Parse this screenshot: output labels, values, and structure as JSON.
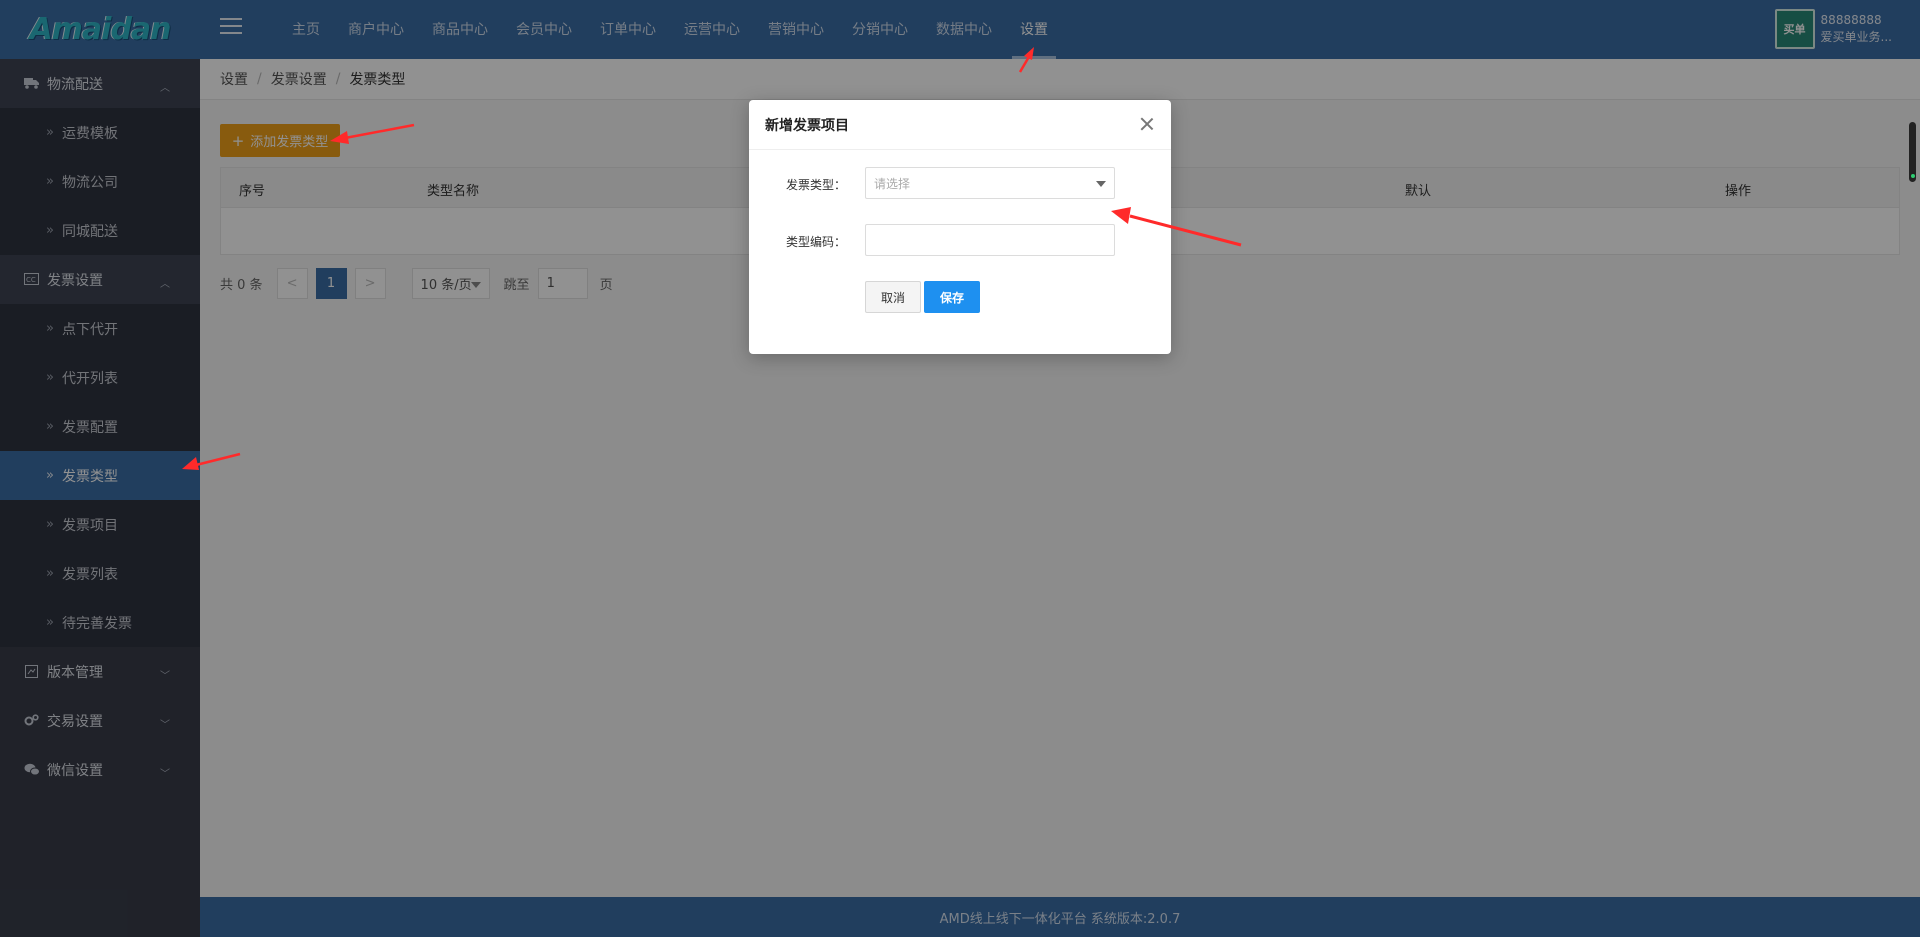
{
  "app": {
    "logo": "Amaidan"
  },
  "topnav": {
    "items": [
      "主页",
      "商户中心",
      "商品中心",
      "会员中心",
      "订单中心",
      "运营中心",
      "营销中心",
      "分销中心",
      "数据中心",
      "设置"
    ],
    "active": "设置"
  },
  "user": {
    "id": "88888888",
    "name": "爱买单业务...",
    "avatar_text": "买单"
  },
  "sidebar": {
    "groups": [
      {
        "label": "物流配送",
        "icon": "truck-icon",
        "open": true,
        "items": [
          "运费模板",
          "物流公司",
          "同城配送"
        ]
      },
      {
        "label": "发票设置",
        "icon": "invoice-icon",
        "open": true,
        "items": [
          "点下代开",
          "代开列表",
          "发票配置",
          "发票类型",
          "发票项目",
          "发票列表",
          "待完善发票"
        ]
      },
      {
        "label": "版本管理",
        "icon": "version-icon",
        "open": false,
        "items": []
      },
      {
        "label": "交易设置",
        "icon": "gears-icon",
        "open": false,
        "items": []
      },
      {
        "label": "微信设置",
        "icon": "wechat-icon",
        "open": false,
        "items": []
      }
    ],
    "active_item": "发票类型"
  },
  "breadcrumb": [
    "设置",
    "发票设置",
    "发票类型"
  ],
  "toolbar": {
    "add_label": "添加发票类型"
  },
  "table": {
    "columns": [
      "序号",
      "类型名称",
      "默认",
      "操作"
    ],
    "rows": []
  },
  "pagination": {
    "total": "共 0 条",
    "prev": "<",
    "current": "1",
    "next": ">",
    "page_size": "10 条/页",
    "jump_label": "跳至",
    "jump_value": "1",
    "page_unit": "页"
  },
  "footer": {
    "text": "AMD线上线下一体化平台 系统版本:2.0.7"
  },
  "modal": {
    "title": "新增发票项目",
    "fields": [
      {
        "label": "发票类型：",
        "type": "select",
        "placeholder": "请选择"
      },
      {
        "label": "类型编码：",
        "type": "text",
        "value": ""
      }
    ],
    "cancel_label": "取消",
    "save_label": "保存"
  },
  "colors": {
    "header": "#3a6da6",
    "sidebar": "#393d49",
    "accent_orange": "#f0a11a",
    "primary_blue": "#1e90f0",
    "annotation_red": "#ff2a2a"
  }
}
